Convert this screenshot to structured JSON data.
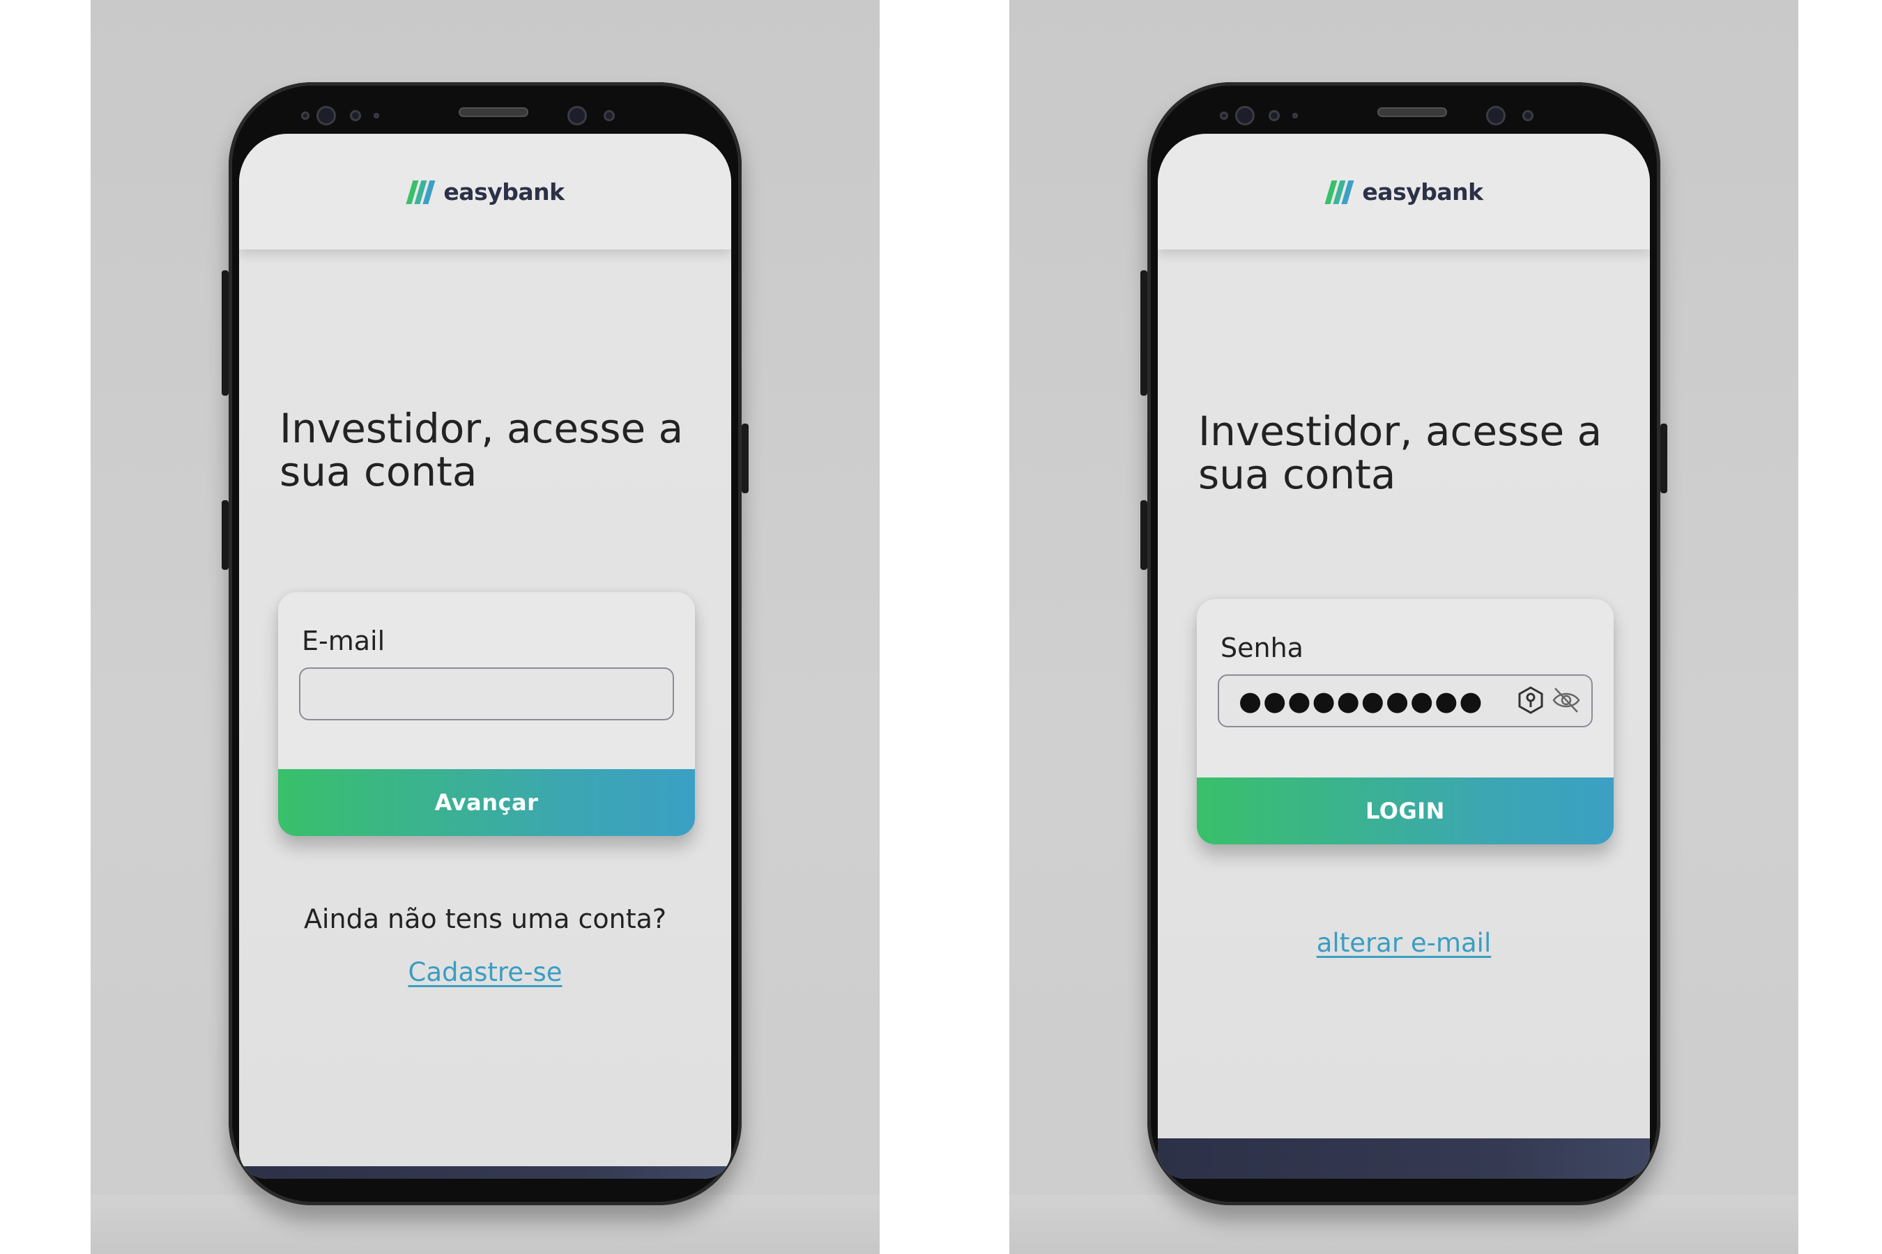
{
  "brand": {
    "name": "easybank",
    "colors": {
      "accent_green": "#39c06a",
      "accent_blue": "#3ba0c4",
      "navy": "#2c3148",
      "link": "#3a9dc2"
    }
  },
  "screens": [
    {
      "headline": "Investidor, acesse a sua conta",
      "field_label": "E-mail",
      "field_value": "",
      "button_label": "Avançar",
      "question": "Ainda não tens uma conta?",
      "link_label": "Cadastre-se"
    },
    {
      "headline": "Investidor, acesse a sua conta",
      "field_label": "Senha",
      "field_value": "●●●●●●●●●●",
      "field_icons": [
        "key-shield-icon",
        "eye-off-icon"
      ],
      "button_label": "LOGIN",
      "link_label": "alterar e-mail"
    }
  ]
}
